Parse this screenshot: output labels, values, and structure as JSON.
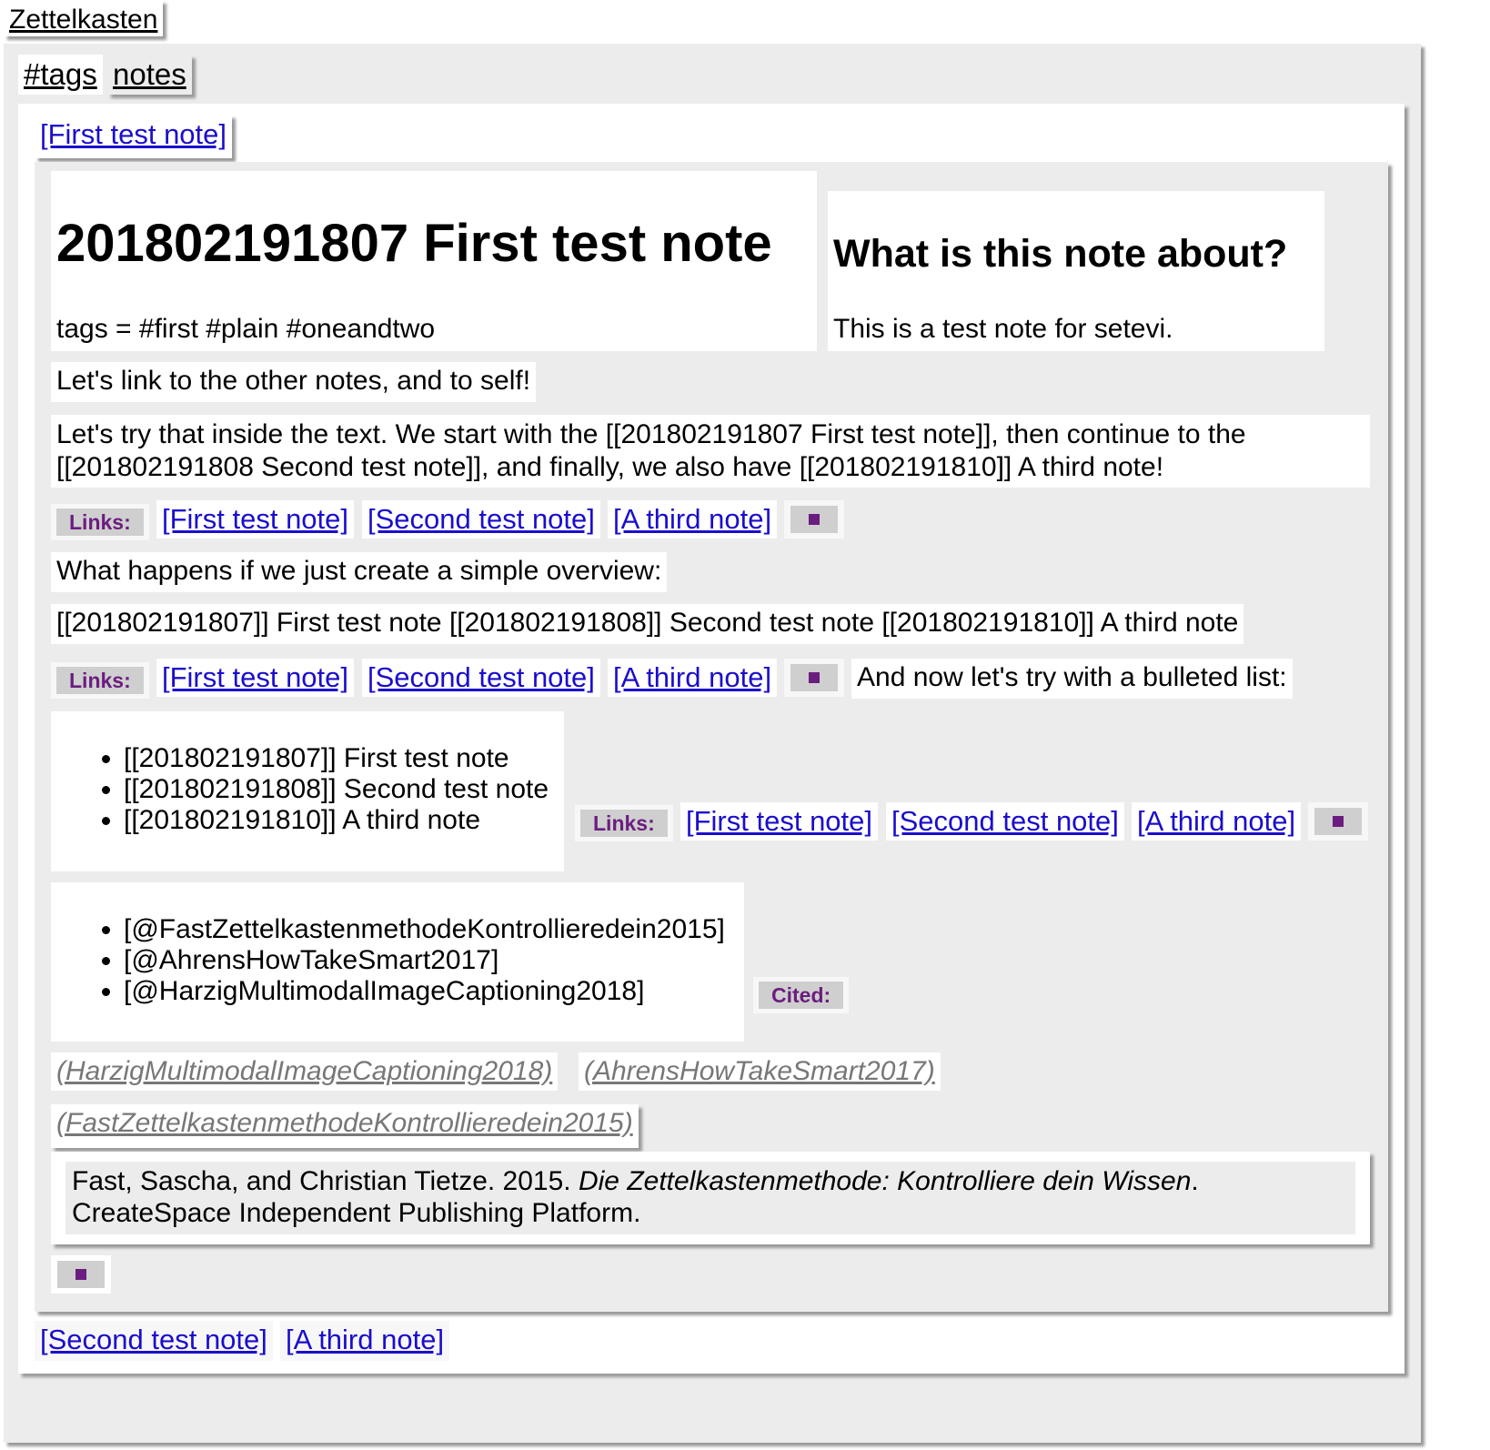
{
  "app": {
    "title": "Zettelkasten"
  },
  "tabs": [
    {
      "label": "#tags"
    },
    {
      "label": "notes"
    }
  ],
  "note_tab": {
    "label": "[First test note]"
  },
  "note": {
    "title": "201802191807 First test note",
    "tags_line": "tags = #first #plain #oneandtwo",
    "about_heading": "What is this note about?",
    "about_text": "This is a test note for setevi.",
    "para1": "Let's link to the other notes, and to self!",
    "para2_line1": "Let's try that inside the text. We start with the [[201802191807 First test note]], then continue to the",
    "para2_line2": "[[201802191808 Second test note]], and finally, we also have [[201802191810]] A third note!",
    "para3": "What happens if we just create a simple overview:",
    "para4": "[[201802191807]] First test note [[201802191808]] Second test note [[201802191810]] A third note",
    "para5": "And now let's try with a bulleted list:",
    "links_label": "Links:",
    "cited_label": "Cited:",
    "links": [
      "[First test note]",
      "[Second test note]",
      "[A third note]"
    ],
    "bullets1": [
      "[[201802191807]] First test note",
      "[[201802191808]] Second test note",
      "[[201802191810]] A third note"
    ],
    "bullets2": [
      "[@FastZettelkastenmethodeKontrollieredein2015]",
      "[@AhrensHowTakeSmart2017]",
      "[@HarzigMultimodalImageCaptioning2018]"
    ],
    "citations": [
      "(HarzigMultimodalImageCaptioning2018)",
      "(AhrensHowTakeSmart2017)",
      "(FastZettelkastenmethodeKontrollieredein2015)"
    ],
    "reference": {
      "authors": "Fast, Sascha, and Christian Tietze. 2015. ",
      "title": "Die Zettelkastenmethode: Kontrolliere dein Wissen",
      "after_title": ".",
      "publisher": "CreateSpace Independent Publishing Platform."
    }
  },
  "bottom_tabs": [
    "[Second test note]",
    "[A third note]"
  ],
  "colors": {
    "accent": "#6b1d7f",
    "link": "#1a0dcc",
    "panel": "#ececec",
    "chip": "#cfcfcf"
  }
}
